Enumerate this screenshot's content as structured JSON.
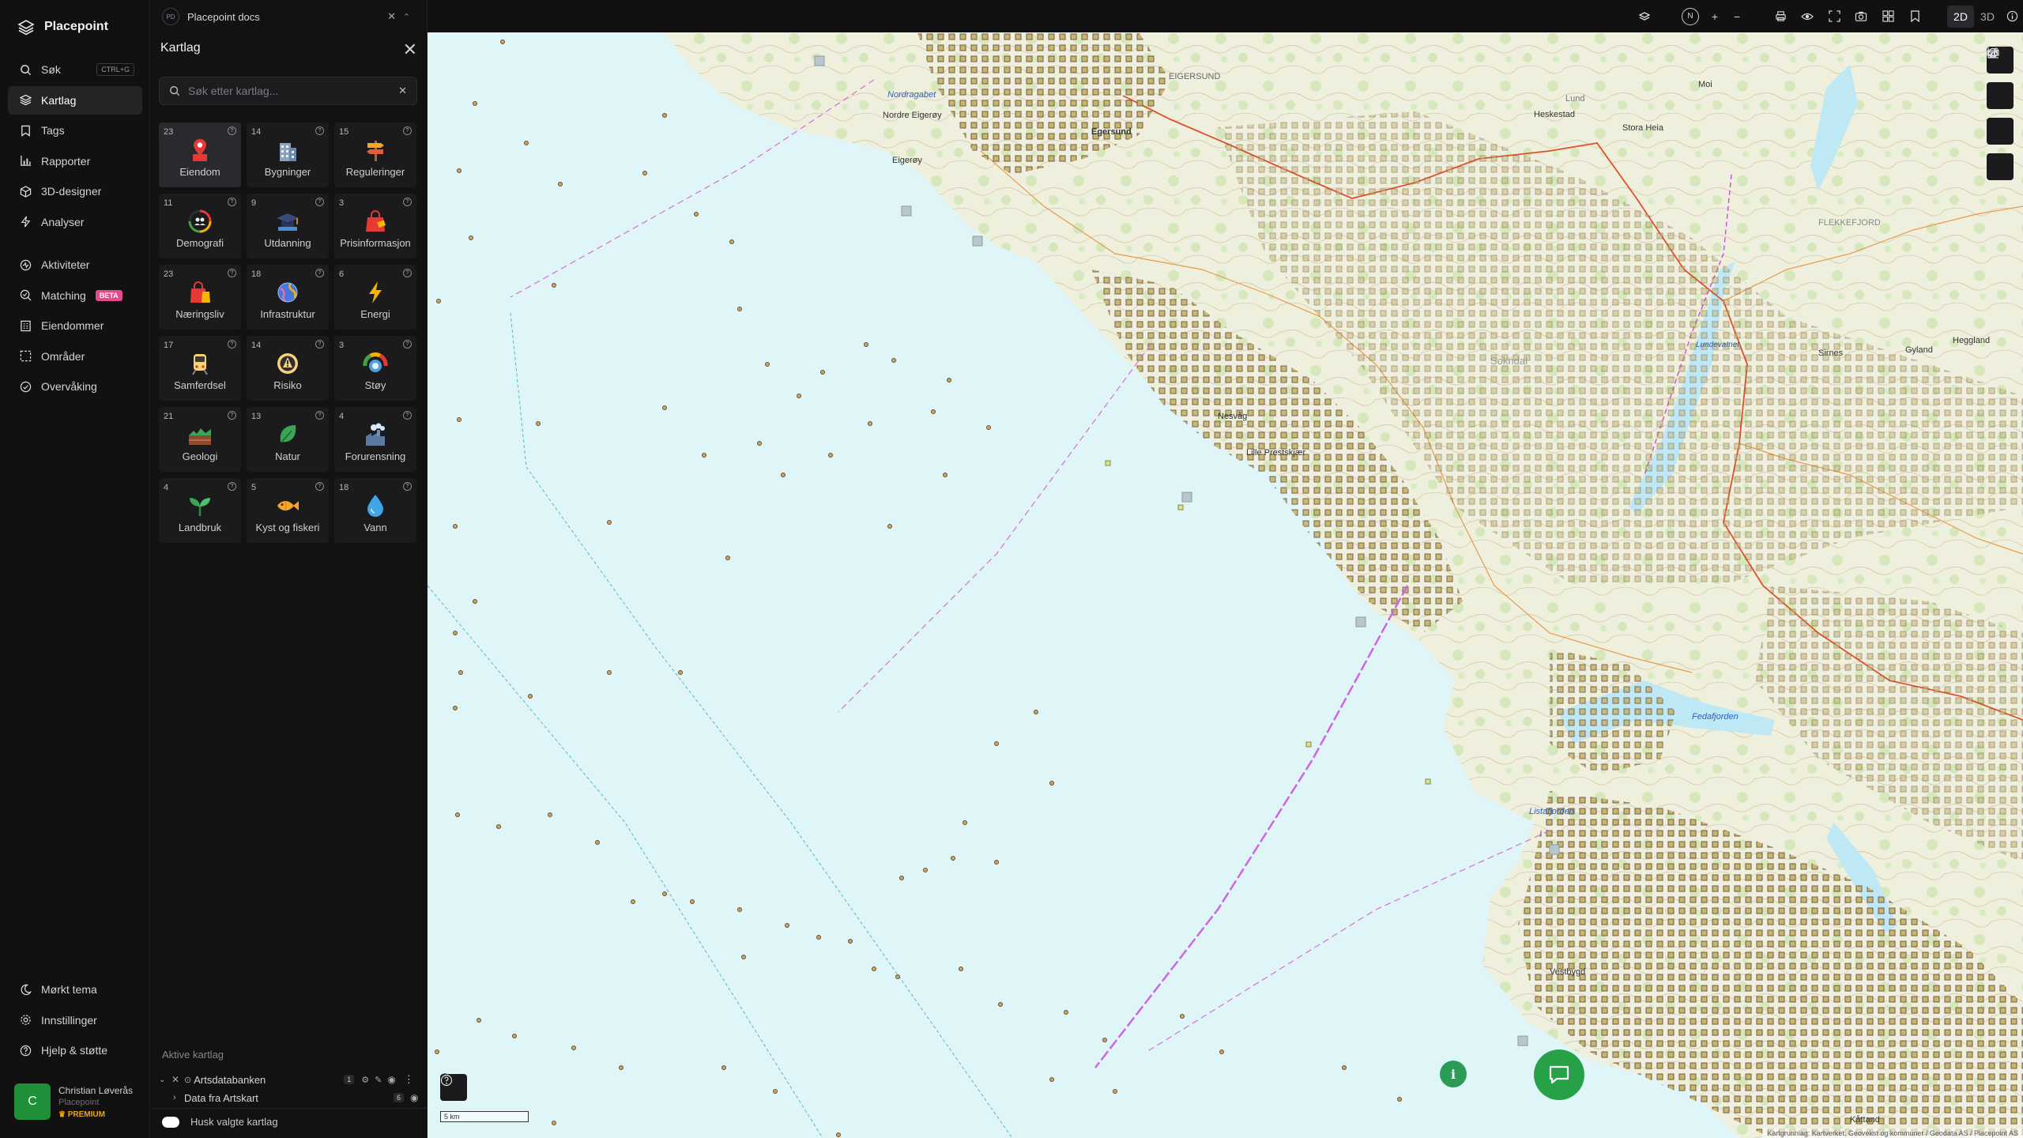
{
  "app": {
    "name": "Placepoint"
  },
  "nav": {
    "items": [
      {
        "label": "Søk",
        "icon": "search-icon",
        "shortcut": "CTRL+G"
      },
      {
        "label": "Kartlag",
        "icon": "layers-icon",
        "active": true
      },
      {
        "label": "Tags",
        "icon": "bookmark-icon"
      },
      {
        "label": "Rapporter",
        "icon": "bar-chart-icon"
      },
      {
        "label": "3D-designer",
        "icon": "cube-icon"
      },
      {
        "label": "Analyser",
        "icon": "bolt-icon"
      },
      {
        "label": "Aktiviteter",
        "icon": "activity-icon"
      },
      {
        "label": "Matching",
        "icon": "match-icon",
        "badge": "BETA"
      },
      {
        "label": "Eiendommer",
        "icon": "building-icon"
      },
      {
        "label": "Områder",
        "icon": "area-icon"
      },
      {
        "label": "Overvåking",
        "icon": "monitor-icon"
      }
    ],
    "bottom": [
      {
        "label": "Mørkt tema",
        "icon": "moon-icon"
      },
      {
        "label": "Innstillinger",
        "icon": "gear-icon"
      },
      {
        "label": "Hjelp & støtte",
        "icon": "help-icon"
      }
    ],
    "user": {
      "initial": "C",
      "name": "Christian Løverås",
      "org": "Placepoint",
      "plan": "PREMIUM"
    }
  },
  "panel": {
    "doc_badge": "PD",
    "doc_title": "Placepoint docs",
    "title": "Kartlag",
    "search_placeholder": "Søk etter kartlag...",
    "tiles": [
      {
        "count": "23",
        "label": "Eiendom",
        "icon": "property-pin-icon",
        "active": true
      },
      {
        "count": "14",
        "label": "Bygninger",
        "icon": "buildings-icon"
      },
      {
        "count": "15",
        "label": "Reguleringer",
        "icon": "signpost-icon"
      },
      {
        "count": "11",
        "label": "Demografi",
        "icon": "demographics-gauge-icon"
      },
      {
        "count": "9",
        "label": "Utdanning",
        "icon": "graduation-cap-icon"
      },
      {
        "count": "3",
        "label": "Prisinformasjon",
        "icon": "price-bag-icon"
      },
      {
        "count": "23",
        "label": "Næringsliv",
        "icon": "shopping-bag-icon"
      },
      {
        "count": "18",
        "label": "Infrastruktur",
        "icon": "globe-network-icon"
      },
      {
        "count": "6",
        "label": "Energi",
        "icon": "lightning-icon"
      },
      {
        "count": "17",
        "label": "Samferdsel",
        "icon": "train-icon"
      },
      {
        "count": "14",
        "label": "Risiko",
        "icon": "hazard-icon"
      },
      {
        "count": "3",
        "label": "Støy",
        "icon": "noise-gauge-icon"
      },
      {
        "count": "21",
        "label": "Geologi",
        "icon": "terrain-icon"
      },
      {
        "count": "13",
        "label": "Natur",
        "icon": "leaf-icon"
      },
      {
        "count": "4",
        "label": "Forurensning",
        "icon": "factory-icon"
      },
      {
        "count": "4",
        "label": "Landbruk",
        "icon": "sprout-icon"
      },
      {
        "count": "5",
        "label": "Kyst og fiskeri",
        "icon": "fish-icon"
      },
      {
        "count": "18",
        "label": "Vann",
        "icon": "water-drop-icon"
      }
    ],
    "active_title": "Aktive kartlag",
    "active_layers": [
      {
        "name": "Artsdatabanken",
        "count": "1"
      },
      {
        "name": "Data fra Artskart",
        "count": "6"
      }
    ],
    "remember_label": "Husk valgte kartlag"
  },
  "toolbar": {
    "compass": "N",
    "mode_2d": "2D",
    "mode_3d": "3D"
  },
  "map": {
    "scale_label": "5 km",
    "attribution": "Kartgrunnlag: Kartverket, Geovekst og kommuner / Geodata AS / Placepoint AS",
    "places": [
      {
        "name": "Nordragabet",
        "water": true
      },
      {
        "name": "Nordre Eigerøy",
        "water": false
      },
      {
        "name": "Eigerøy",
        "water": false
      },
      {
        "name": "Egersund",
        "water": false
      },
      {
        "name": "EIGERSUND",
        "water": false
      },
      {
        "name": "Lund",
        "water": false
      },
      {
        "name": "Heskestad",
        "water": false
      },
      {
        "name": "Moi",
        "water": false
      },
      {
        "name": "Stora Heia",
        "water": false
      },
      {
        "name": "Lundevatnet",
        "water": true
      },
      {
        "name": "FLEKKEFJORD",
        "water": false
      },
      {
        "name": "Sokndal",
        "water": false
      },
      {
        "name": "Nesvåg",
        "water": false
      },
      {
        "name": "Lille Prestskjær",
        "water": false
      },
      {
        "name": "Listafjorden",
        "water": true
      },
      {
        "name": "Fedafjorden",
        "water": true
      },
      {
        "name": "Vestbygd",
        "water": false
      },
      {
        "name": "Kåttand",
        "water": false
      },
      {
        "name": "Gyland",
        "water": false
      },
      {
        "name": "Heggland",
        "water": false
      },
      {
        "name": "Sirnes",
        "water": false
      }
    ]
  },
  "colors": {
    "accent": "#27a148",
    "beta": "#e24a8b",
    "sea": "#dff5f8",
    "land": "#f1f0e3",
    "forest": "#cfe6b5",
    "poi_fill": "#b8a34a",
    "poi_stroke": "#6b4b3a"
  }
}
